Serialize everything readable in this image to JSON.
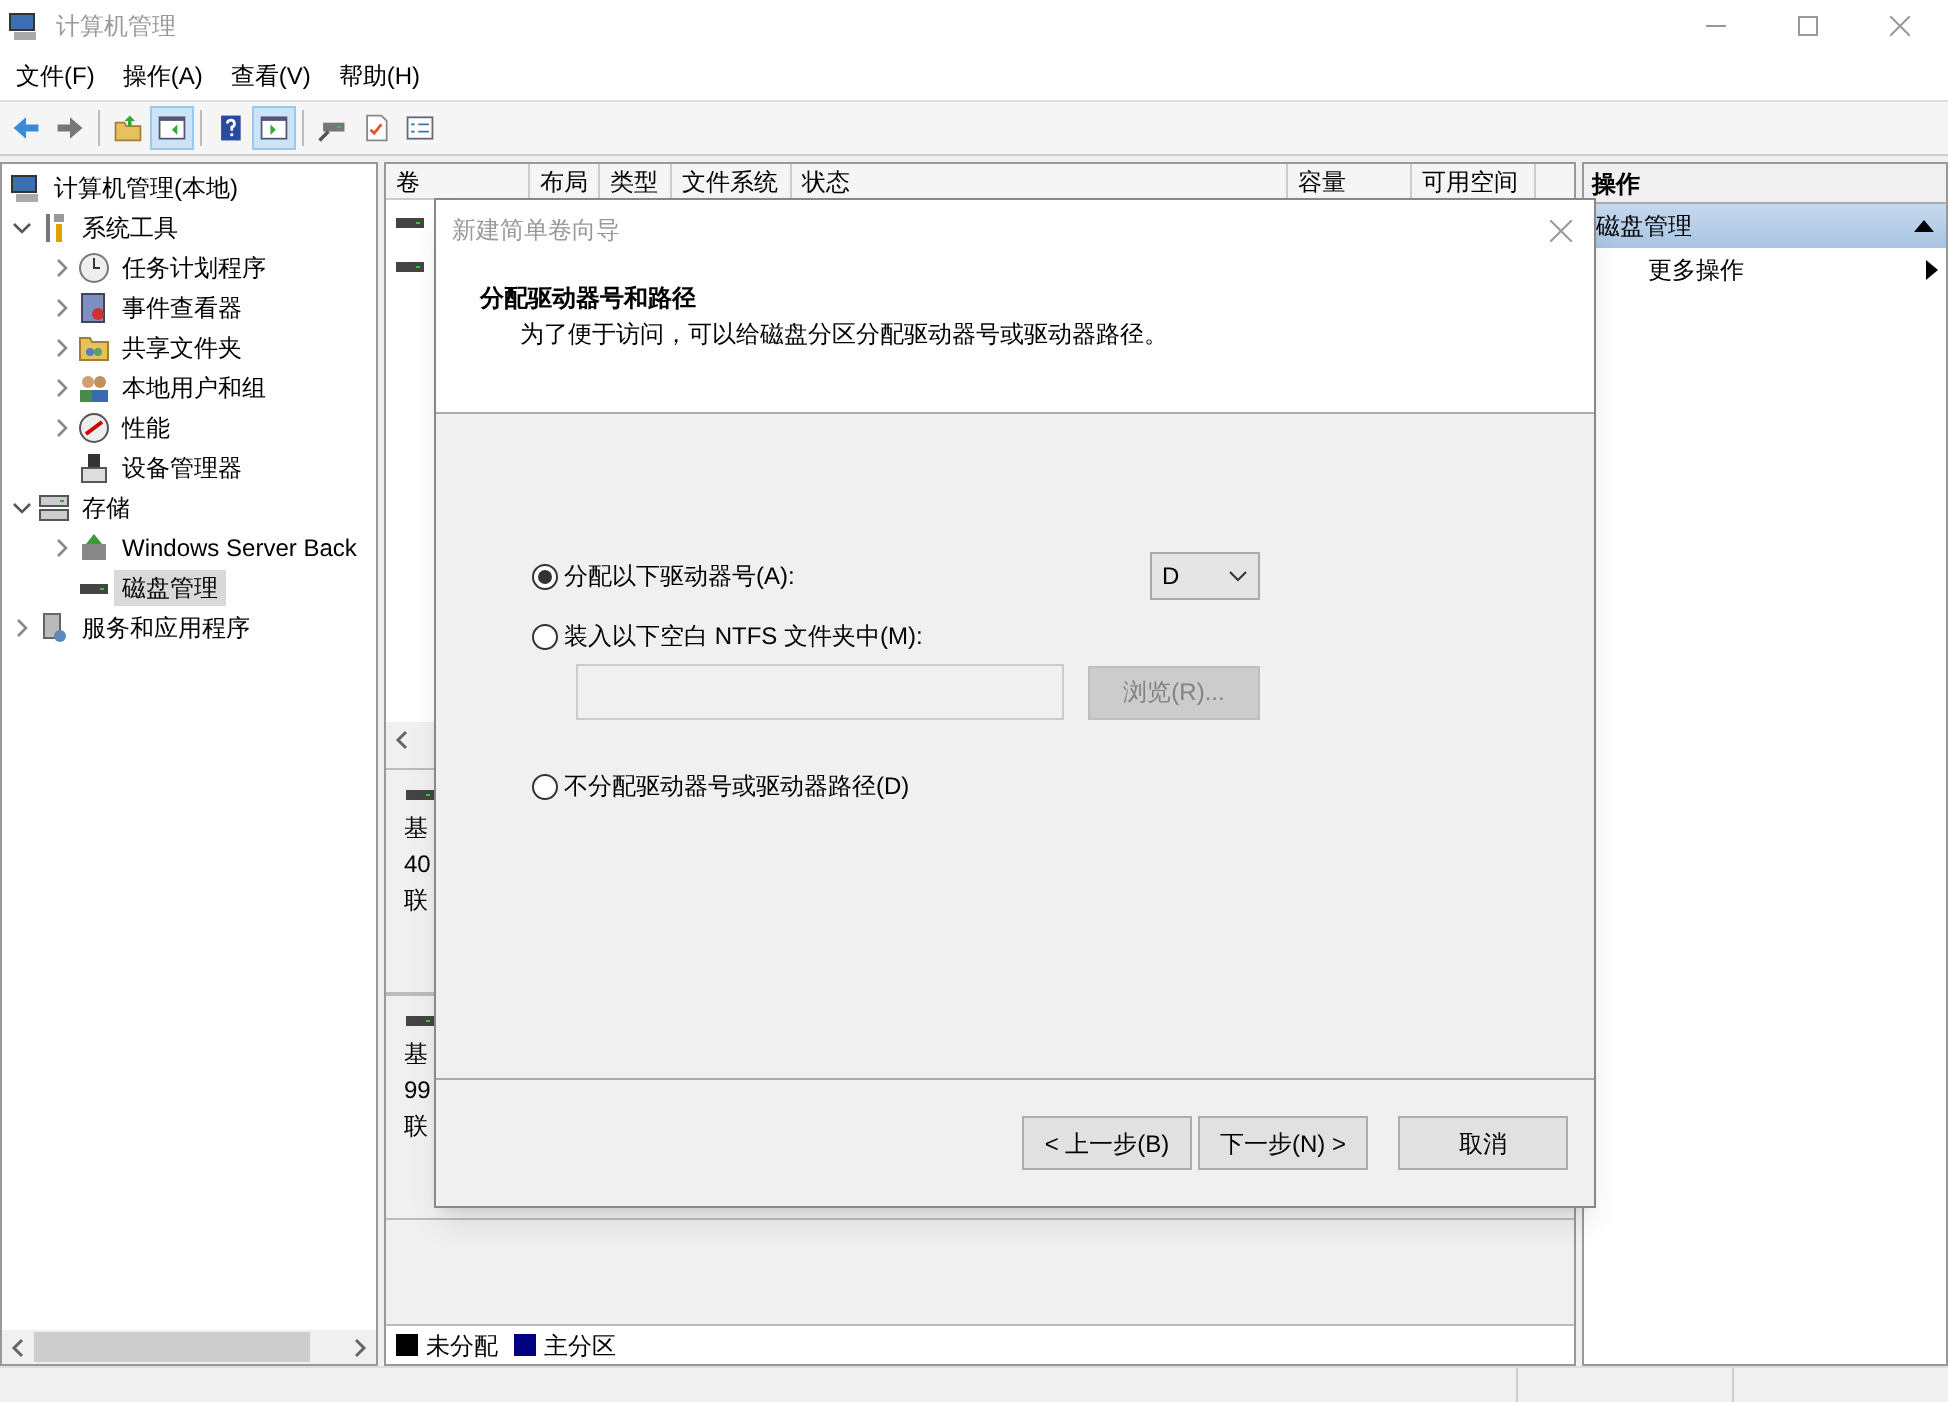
{
  "window": {
    "title": "计算机管理"
  },
  "menu": [
    "文件(F)",
    "操作(A)",
    "查看(V)",
    "帮助(H)"
  ],
  "toolbar": [
    {
      "pressed": false
    },
    {
      "pressed": false
    },
    {
      "pressed": false
    },
    {
      "pressed": true
    },
    {
      "pressed": false
    },
    {
      "pressed": true
    },
    {
      "pressed": false
    },
    {
      "pressed": false
    },
    {
      "pressed": false
    }
  ],
  "tree": [
    {
      "label": "计算机管理(本地)",
      "kind": "root",
      "selected": false,
      "children": [
        {
          "label": "系统工具",
          "kind": "node",
          "expanded": true,
          "selected": false,
          "children": [
            {
              "label": "任务计划程序",
              "kind": "node",
              "expanded": false,
              "selected": false
            },
            {
              "label": "事件查看器",
              "kind": "node",
              "expanded": false,
              "selected": false
            },
            {
              "label": "共享文件夹",
              "kind": "node",
              "expanded": false,
              "selected": false
            },
            {
              "label": "本地用户和组",
              "kind": "node",
              "expanded": false,
              "selected": false
            },
            {
              "label": "性能",
              "kind": "node",
              "expanded": false,
              "selected": false
            },
            {
              "label": "设备管理器",
              "kind": "leaf",
              "selected": false
            }
          ]
        },
        {
          "label": "存储",
          "kind": "node",
          "expanded": true,
          "selected": false,
          "children": [
            {
              "label": "Windows Server Back",
              "kind": "node",
              "expanded": false,
              "selected": false
            },
            {
              "label": "磁盘管理",
              "kind": "leaf",
              "selected": true
            }
          ]
        },
        {
          "label": "服务和应用程序",
          "kind": "node",
          "expanded": false,
          "selected": false
        }
      ]
    }
  ],
  "volume_table": {
    "columns": [
      "卷",
      "布局",
      "类型",
      "文件系统",
      "状态",
      "容量",
      "可用空间"
    ]
  },
  "disks": [
    {
      "lines": [
        "基",
        "40",
        "联"
      ]
    },
    {
      "lines": [
        "基",
        "99",
        "联"
      ]
    }
  ],
  "legend": [
    {
      "label": "未分配",
      "color": "#000000"
    },
    {
      "label": "主分区",
      "color": "#000080"
    }
  ],
  "actions": {
    "header": "操作",
    "section": "磁盘管理",
    "items": [
      "更多操作"
    ]
  },
  "dialog": {
    "title": "新建简单卷向导",
    "heading": "分配驱动器号和路径",
    "subtitle": "为了便于访问，可以给磁盘分区分配驱动器号或驱动器路径。",
    "options": [
      {
        "label": "分配以下驱动器号(A):",
        "selected": true
      },
      {
        "label": "装入以下空白 NTFS 文件夹中(M):",
        "selected": false
      },
      {
        "label": "不分配驱动器号或驱动器路径(D)",
        "selected": false
      }
    ],
    "drive_letter": "D",
    "folder_path": {
      "disabled": true
    },
    "browse": {
      "label": "浏览(R)...",
      "disabled": true
    },
    "buttons": [
      {
        "label": "< 上一步(B)",
        "kind": "back"
      },
      {
        "label": "下一步(N) >",
        "kind": "next"
      },
      {
        "label": "取消",
        "kind": "cancel"
      }
    ]
  }
}
